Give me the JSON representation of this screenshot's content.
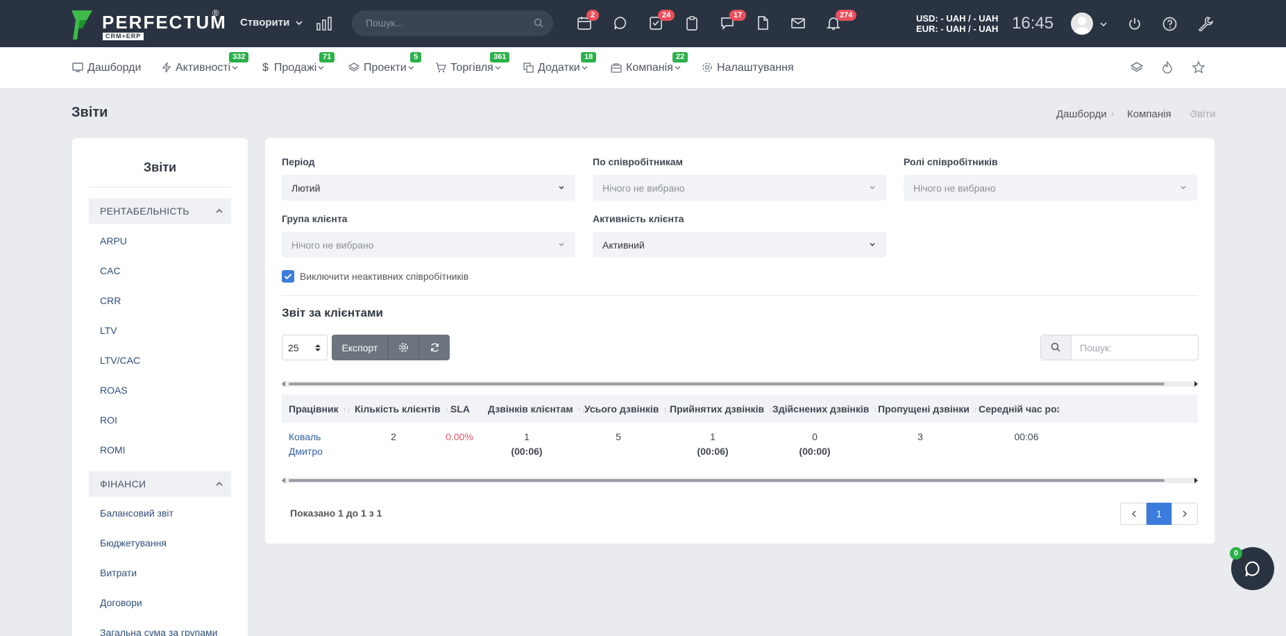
{
  "brand": {
    "name": "PERFECTUM",
    "reg": "®",
    "sub": "CRM+ERP"
  },
  "topbar": {
    "create_label": "Створити",
    "search_placeholder": "Пошук...",
    "badges": {
      "calendar": "2",
      "tasks": "24",
      "messages": "17",
      "notifications": "274"
    },
    "currency_usd": "USD: - UAH / - UAH",
    "currency_eur": "EUR: - UAH / - UAH",
    "time": "16:45"
  },
  "nav": {
    "items": [
      {
        "label": "Дашборди",
        "badge": ""
      },
      {
        "label": "Активності",
        "badge": "332"
      },
      {
        "label": "Продажі",
        "badge": "71"
      },
      {
        "label": "Проекти",
        "badge": "5"
      },
      {
        "label": "Торгівля",
        "badge": "361"
      },
      {
        "label": "Додатки",
        "badge": "18"
      },
      {
        "label": "Компанія",
        "badge": "22"
      },
      {
        "label": "Налаштування",
        "badge": ""
      }
    ]
  },
  "page": {
    "title": "Звіти",
    "breadcrumb": [
      "Дашборди",
      "Компанія",
      "Звіти"
    ]
  },
  "sidebar": {
    "title": "Звіти",
    "sections": [
      {
        "label": "РЕНТАБЕЛЬНІСТЬ",
        "items": [
          "ARPU",
          "CAC",
          "CRR",
          "LTV",
          "LTV/CAC",
          "ROAS",
          "ROI",
          "ROMI"
        ]
      },
      {
        "label": "ФІНАНСИ",
        "items": [
          "Балансовий звіт",
          "Бюджетування",
          "Витрати",
          "Договори",
          "Загальна сума за групами"
        ]
      }
    ]
  },
  "filters": {
    "period_label": "Період",
    "period_value": "Лютий",
    "employees_label": "По співробітникам",
    "employees_value": "Нічого не вибрано",
    "roles_label": "Ролі співробітників",
    "roles_value": "Нічого не вибрано",
    "group_label": "Група клієнта",
    "group_value": "Нічого не вибрано",
    "activity_label": "Активність клієнта",
    "activity_value": "Активний",
    "exclude_inactive_label": "Виключити неактивних співробітників",
    "exclude_inactive_checked": true
  },
  "report": {
    "title": "Звіт за клієнтами",
    "page_size": "25",
    "export_label": "Експорт",
    "search_placeholder": "Пошук:",
    "columns": [
      "Працівник",
      "Кількість клієнтів",
      "SLA",
      "Дзвінків клієнтам",
      "Усього дзвінків",
      "Прийнятих дзвінків",
      "Здійснених дзвінків",
      "Пропущені дзвінки",
      "Середній час розмо"
    ],
    "rows": [
      {
        "employee_first": "Коваль",
        "employee_last": "Дмитро",
        "clients": "2",
        "sla": "0.00%",
        "calls_to_clients": "1",
        "calls_to_clients_time": "(00:06)",
        "total_calls": "5",
        "accepted": "1",
        "accepted_time": "(00:06)",
        "made": "0",
        "made_time": "(00:00)",
        "missed": "3",
        "avg_time": "00:06"
      }
    ],
    "showing": "Показано 1 до 1 з 1",
    "current_page": "1"
  },
  "chat": {
    "badge": "0"
  }
}
